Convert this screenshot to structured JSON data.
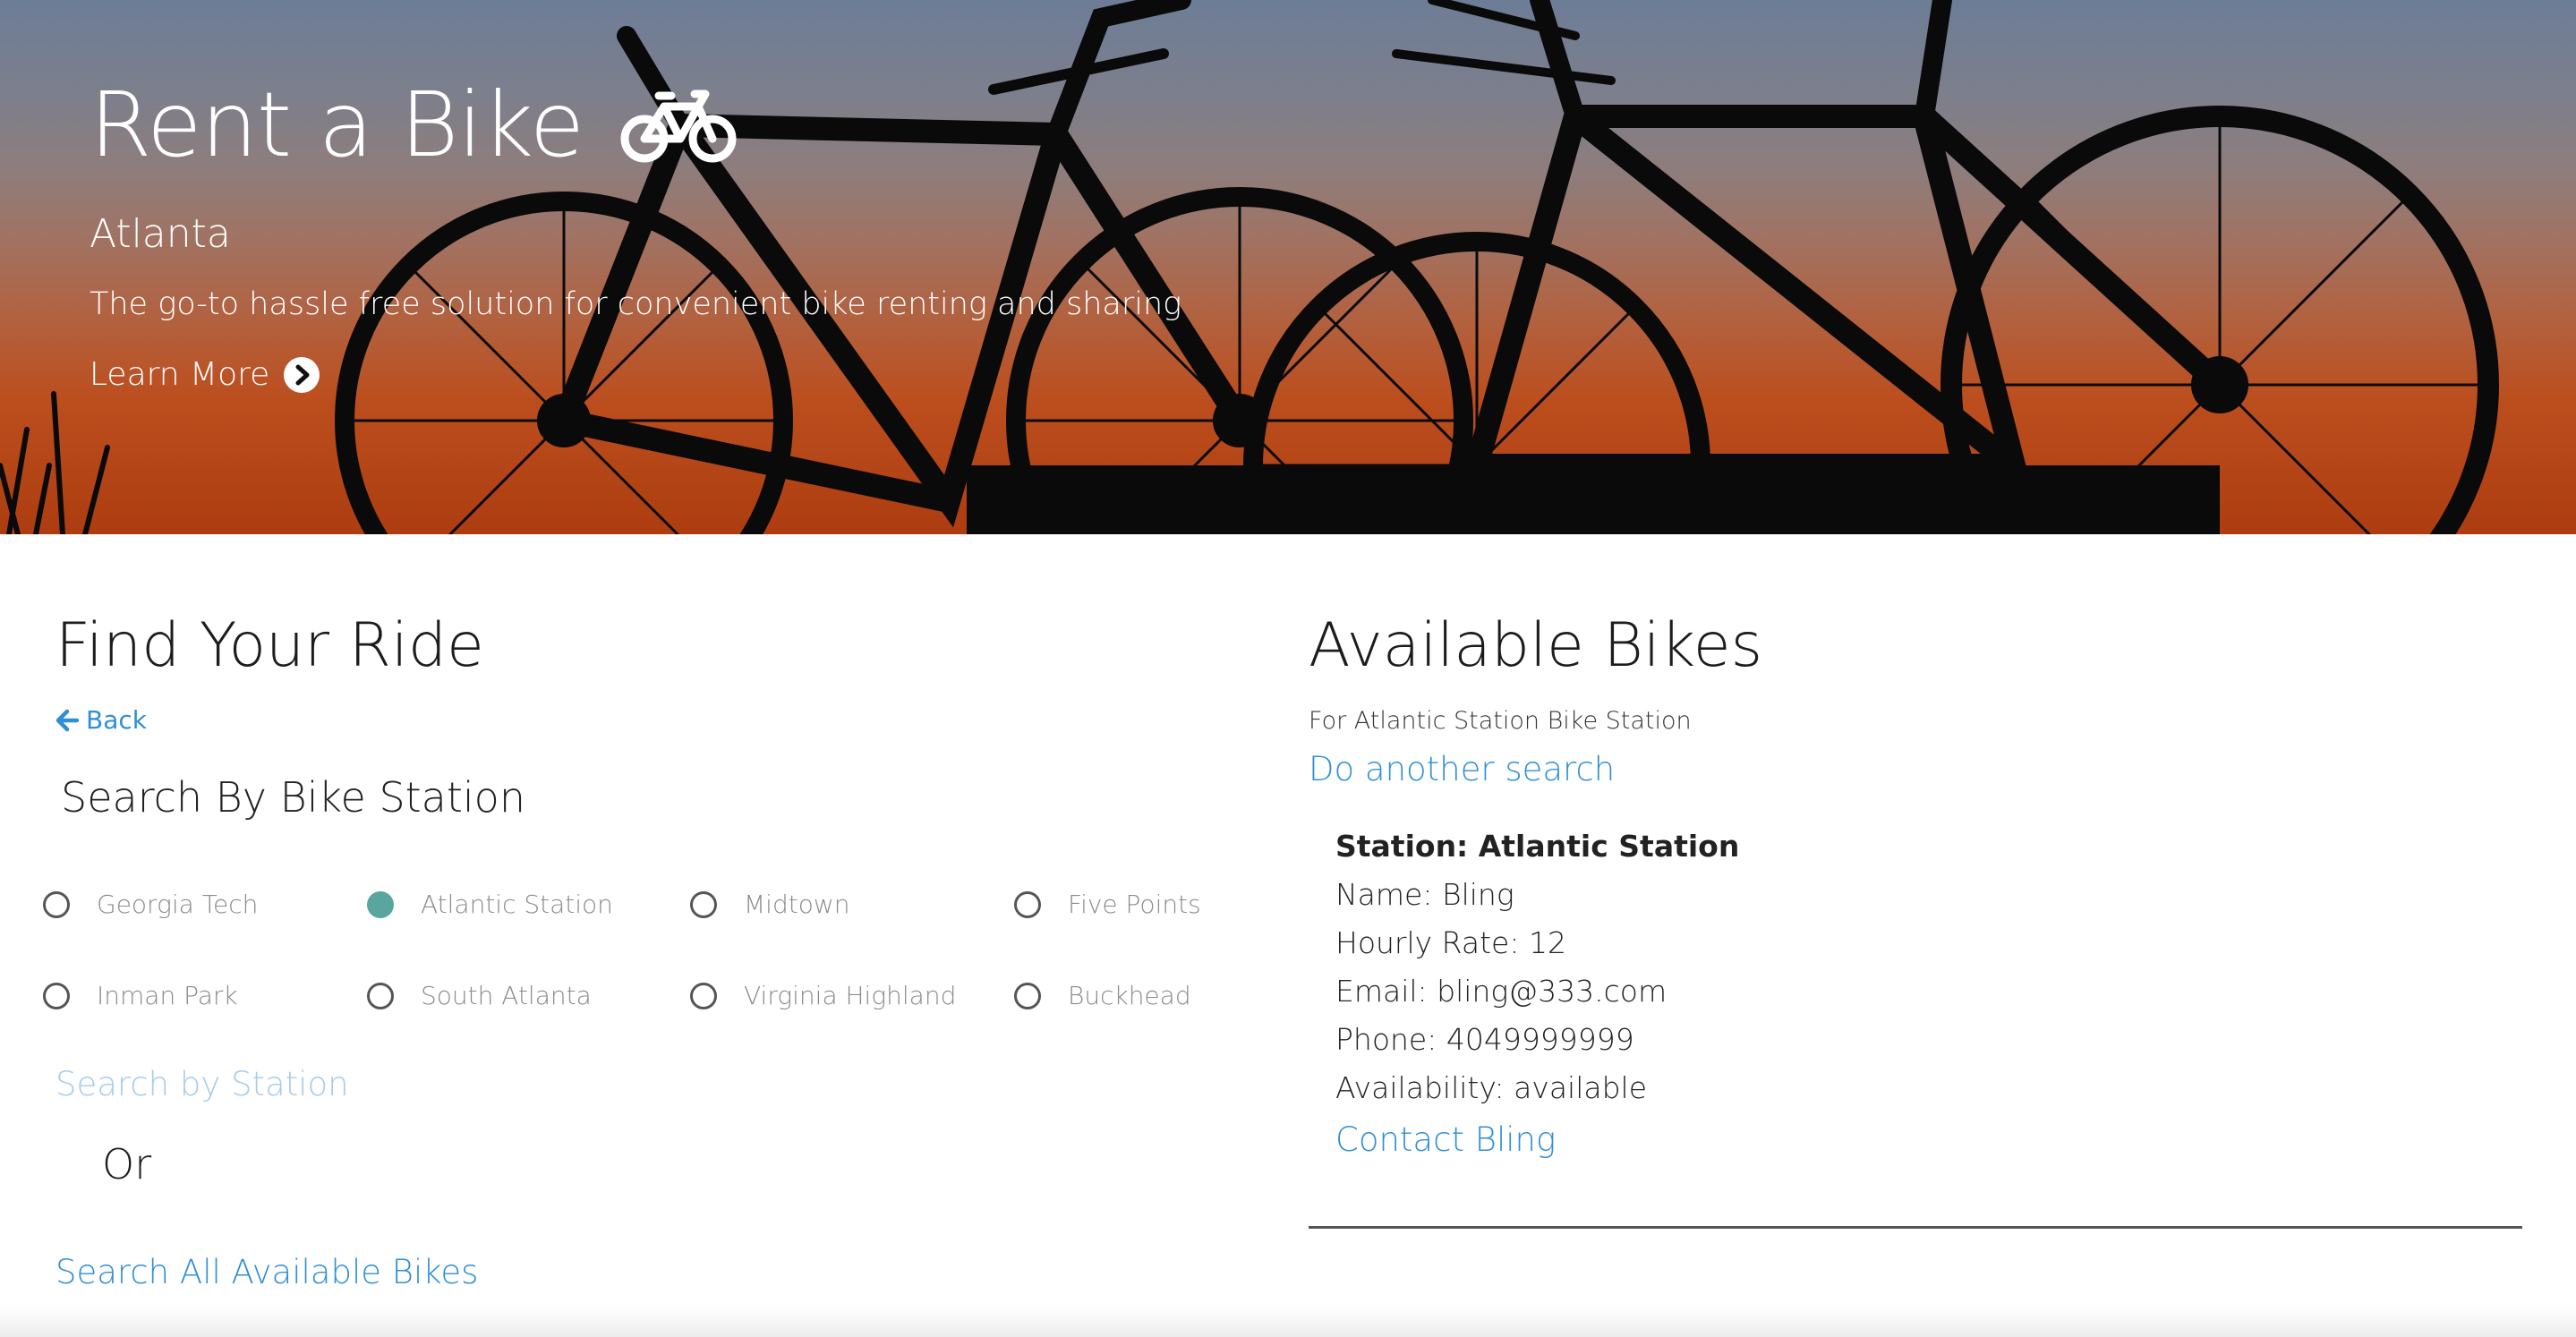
{
  "hero": {
    "title": "Rent a Bike",
    "title_icon": "bicycle-icon",
    "city": "Atlanta",
    "tagline": "The go-to hassle free solution for convenient bike renting and sharing",
    "learn_more_label": "Learn More",
    "learn_more_icon": "chevron-circle-right-icon"
  },
  "search": {
    "title": "Find Your Ride",
    "back_label": "Back",
    "back_icon": "arrow-left-icon",
    "section_title": "Search By Bike Station",
    "stations": [
      {
        "label": "Georgia Tech",
        "checked": false
      },
      {
        "label": "Atlantic Station",
        "checked": true
      },
      {
        "label": "Midtown",
        "checked": false
      },
      {
        "label": "Five Points",
        "checked": false
      },
      {
        "label": "Inman Park",
        "checked": false
      },
      {
        "label": "South Atlanta",
        "checked": false
      },
      {
        "label": "Virginia Highland",
        "checked": false
      },
      {
        "label": "Buckhead",
        "checked": false
      }
    ],
    "search_by_station_label": "Search by Station",
    "or_label": "Or",
    "search_all_label": "Search All Available Bikes"
  },
  "results": {
    "title": "Available Bikes",
    "for_station": "For Atlantic Station Bike Station",
    "another_search_label": "Do another search",
    "bikes": [
      {
        "station": "Station: Atlantic Station",
        "name": "Name: Bling",
        "hourly_rate": "Hourly Rate: 12",
        "email": "Email: bling@333.com",
        "phone": "Phone: 4049999999",
        "availability": "Availability: available",
        "contact_label": "Contact Bling"
      }
    ]
  },
  "colors": {
    "link": "#2f8fd6",
    "link_disabled": "#a6ccea",
    "radio_checked": "#58a69e",
    "hero_top": "#6d7d97",
    "hero_bottom": "#ad3d10"
  }
}
